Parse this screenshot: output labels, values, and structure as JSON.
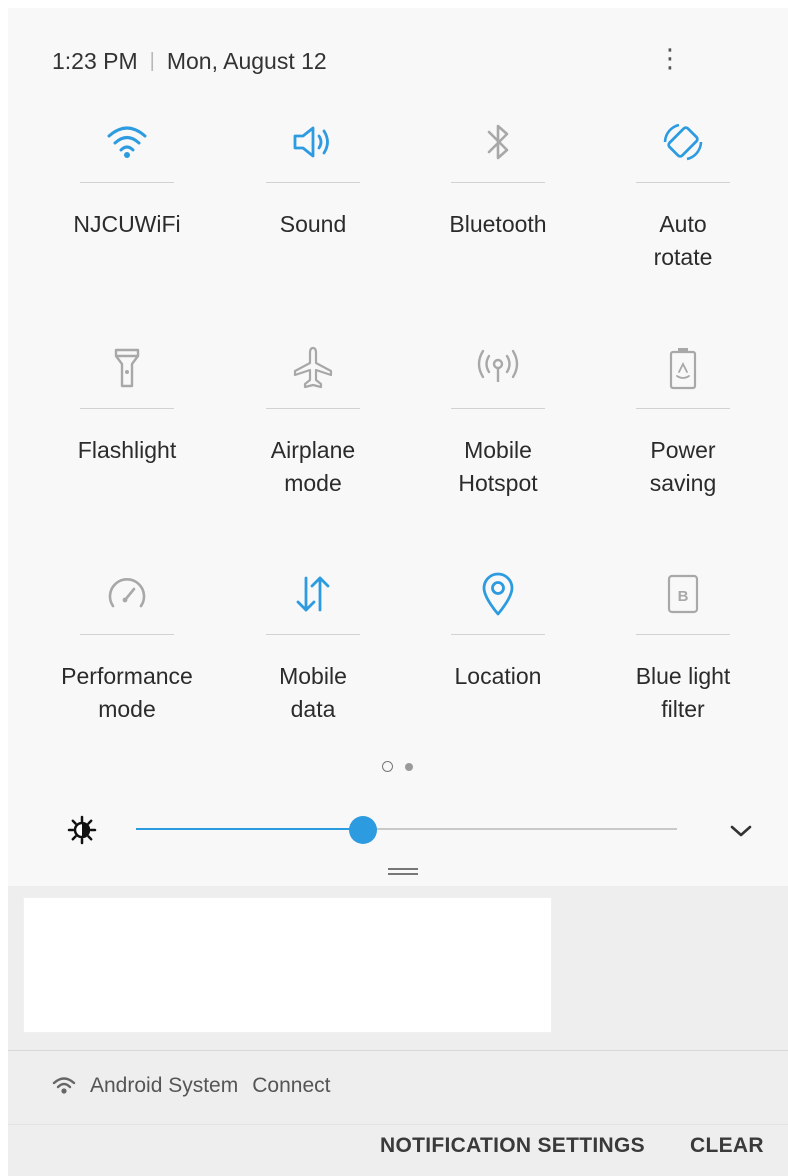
{
  "status": {
    "time": "1:23 PM",
    "date": "Mon, August 12"
  },
  "tiles": [
    {
      "label": "NJCUWiFi",
      "icon": "wifi-icon",
      "active": true
    },
    {
      "label": "Sound",
      "icon": "volume-icon",
      "active": true
    },
    {
      "label": "Bluetooth",
      "icon": "bluetooth-icon",
      "active": false
    },
    {
      "label": "Auto\nrotate",
      "icon": "auto-rotate-icon",
      "active": true
    },
    {
      "label": "Flashlight",
      "icon": "flashlight-icon",
      "active": false
    },
    {
      "label": "Airplane\nmode",
      "icon": "airplane-icon",
      "active": false
    },
    {
      "label": "Mobile\nHotspot",
      "icon": "hotspot-icon",
      "active": false
    },
    {
      "label": "Power\nsaving",
      "icon": "battery-icon",
      "active": false
    },
    {
      "label": "Performance\nmode",
      "icon": "speedometer-icon",
      "active": false
    },
    {
      "label": "Mobile\ndata",
      "icon": "mobile-data-icon",
      "active": true
    },
    {
      "label": "Location",
      "icon": "location-icon",
      "active": true
    },
    {
      "label": "Blue light\nfilter",
      "icon": "blue-light-icon",
      "active": false
    }
  ],
  "pager": {
    "pages": 2,
    "current": 1
  },
  "brightness": {
    "level": 0.42
  },
  "notification": {
    "app": "Android System",
    "text": "Connect"
  },
  "footer": {
    "settings_label": "NOTIFICATION SETTINGS",
    "clear_label": "CLEAR"
  },
  "colors": {
    "accent": "#2d9be0",
    "inactive_icon": "#a8a8a8"
  }
}
